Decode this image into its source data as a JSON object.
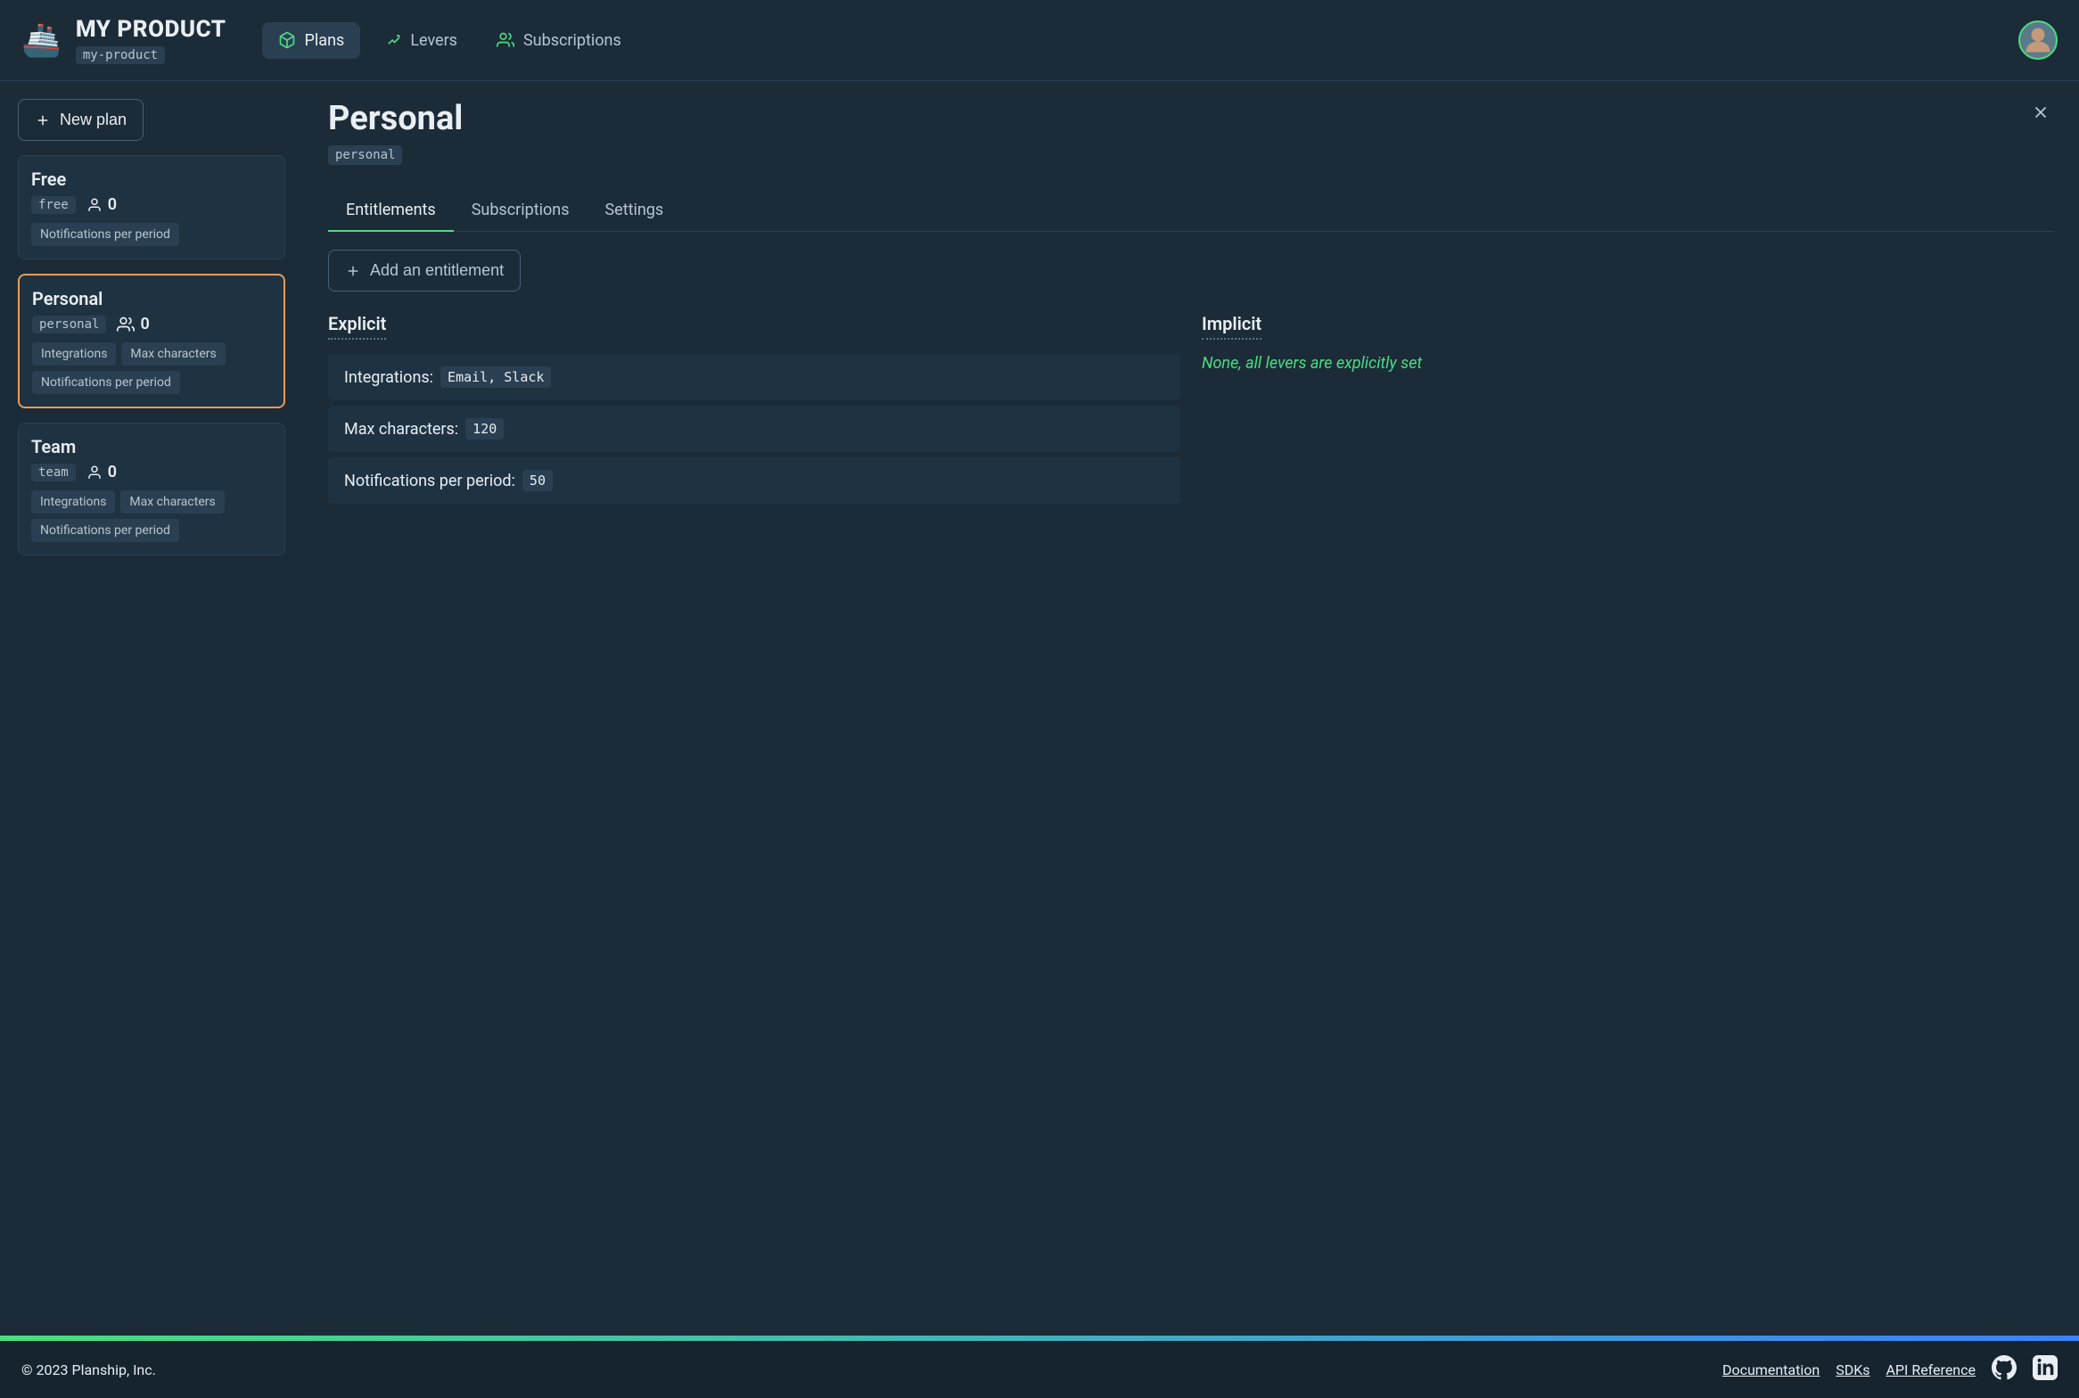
{
  "header": {
    "product_name": "MY PRODUCT",
    "product_slug": "my-product",
    "nav": [
      {
        "label": "Plans",
        "icon": "plans"
      },
      {
        "label": "Levers",
        "icon": "levers"
      },
      {
        "label": "Subscriptions",
        "icon": "subscriptions"
      }
    ]
  },
  "sidebar": {
    "new_plan_label": "New plan",
    "plans": [
      {
        "name": "Free",
        "slug": "free",
        "count": "0",
        "tags": [
          "Notifications per period"
        ],
        "selected": false
      },
      {
        "name": "Personal",
        "slug": "personal",
        "count": "0",
        "tags": [
          "Integrations",
          "Max characters",
          "Notifications per period"
        ],
        "selected": true
      },
      {
        "name": "Team",
        "slug": "team",
        "count": "0",
        "tags": [
          "Integrations",
          "Max characters",
          "Notifications per period"
        ],
        "selected": false
      }
    ]
  },
  "content": {
    "title": "Personal",
    "title_slug": "personal",
    "tabs": [
      "Entitlements",
      "Subscriptions",
      "Settings"
    ],
    "active_tab": 0,
    "add_entitlement_label": "Add an entitlement",
    "explicit_header": "Explicit",
    "implicit_header": "Implicit",
    "entitlements": [
      {
        "label": "Integrations:",
        "value": "Email, Slack"
      },
      {
        "label": "Max characters:",
        "value": "120"
      },
      {
        "label": "Notifications per period:",
        "value": "50"
      }
    ],
    "implicit_text": "None, all levers are explicitly set"
  },
  "footer": {
    "copyright": "© 2023 Planship, Inc.",
    "links": [
      "Documentation",
      "SDKs",
      "API Reference"
    ]
  }
}
